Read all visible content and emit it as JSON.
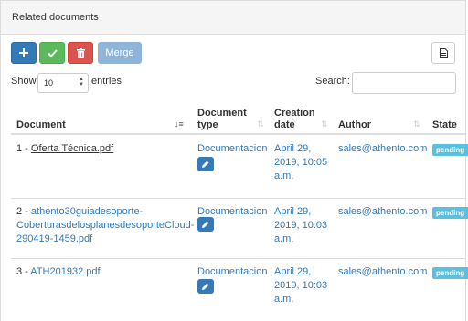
{
  "panel": {
    "title": "Related documents"
  },
  "toolbar": {
    "add_icon": "plus-icon",
    "confirm_icon": "check-icon",
    "delete_icon": "trash-icon",
    "merge_label": "Merge",
    "export_icon": "file-icon"
  },
  "length": {
    "show_label": "Show",
    "selected": "10",
    "entries_label": "entries"
  },
  "search": {
    "label": "Search:",
    "value": "",
    "placeholder": ""
  },
  "table": {
    "headers": {
      "document": "Document",
      "type_line1": "Document",
      "type_line2": "type",
      "date_line1": "Creation",
      "date_line2": "date",
      "author": "Author",
      "state": "State"
    },
    "rows": [
      {
        "prefix": "1 - ",
        "doc_name": "Oferta Técnica.pdf",
        "type": "Documentacion",
        "date_line1": "April 29,",
        "date_line2": "2019, 10:05",
        "date_line3": "a.m.",
        "author": "sales@athento.com",
        "state": "pending"
      },
      {
        "prefix": "2 - ",
        "doc_line1": "athento30guiadesoporte-",
        "doc_line2": "CoberturasdelosplanesdesoporteCloud-",
        "doc_line3": "290419-1459.pdf",
        "type": "Documentacion",
        "date_line1": "April 29,",
        "date_line2": "2019, 10:03",
        "date_line3": "a.m.",
        "author": "sales@athento.com",
        "state": "pending"
      },
      {
        "prefix": "3 - ",
        "doc_name": "ATH201932.pdf",
        "type": "Documentacion",
        "date_line1": "April 29,",
        "date_line2": "2019, 10:03",
        "date_line3": "a.m.",
        "author": "sales@athento.com",
        "state": "pending"
      }
    ]
  },
  "colors": {
    "primary": "#337ab7",
    "success": "#5cb85c",
    "danger": "#d9534f",
    "info": "#5bc0de"
  }
}
